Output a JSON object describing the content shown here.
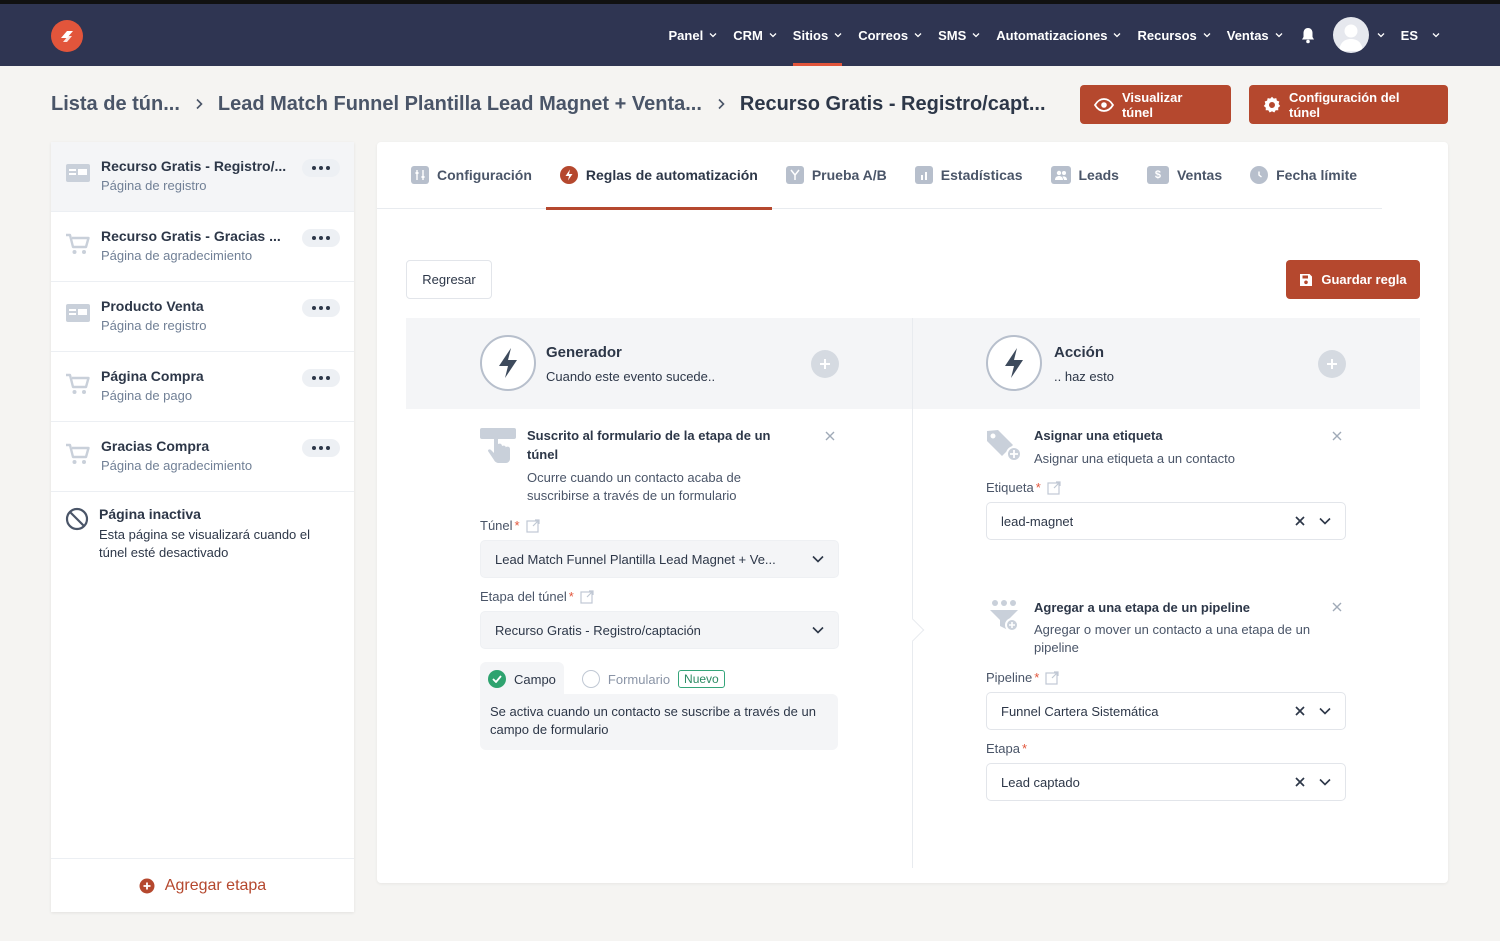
{
  "nav": {
    "items": [
      {
        "label": "Panel"
      },
      {
        "label": "CRM"
      },
      {
        "label": "Sitios",
        "active": true
      },
      {
        "label": "Correos"
      },
      {
        "label": "SMS"
      },
      {
        "label": "Automatizaciones"
      },
      {
        "label": "Recursos"
      },
      {
        "label": "Ventas"
      }
    ],
    "lang": "ES"
  },
  "breadcrumb": {
    "items": [
      "Lista de tún...",
      "Lead Match Funnel Plantilla Lead Magnet + Venta...",
      "Recurso Gratis - Registro/capt..."
    ]
  },
  "header_buttons": {
    "preview": "Visualizar túnel",
    "settings": "Configuración del túnel"
  },
  "sidebar": {
    "steps": [
      {
        "title": "Recurso Gratis - Registro/...",
        "subtitle": "Página de registro",
        "icon": "form-page-icon"
      },
      {
        "title": "Recurso Gratis - Gracias ...",
        "subtitle": "Página de agradecimiento",
        "icon": "cart-icon"
      },
      {
        "title": "Producto Venta",
        "subtitle": "Página de registro",
        "icon": "form-page-icon"
      },
      {
        "title": "Página Compra",
        "subtitle": "Página de pago",
        "icon": "cart-icon"
      },
      {
        "title": "Gracias Compra",
        "subtitle": "Página de agradecimiento",
        "icon": "cart-icon"
      }
    ],
    "inactive": {
      "title": "Página inactiva",
      "description": "Esta página se visualizará cuando el túnel esté desactivado"
    },
    "add_step": "Agregar etapa"
  },
  "tabs": [
    {
      "label": "Configuración",
      "icon": "sliders-icon"
    },
    {
      "label": "Reglas de automatización",
      "icon": "bolt-icon",
      "active": true
    },
    {
      "label": "Prueba A/B",
      "icon": "split-icon"
    },
    {
      "label": "Estadísticas",
      "icon": "bar-chart-icon"
    },
    {
      "label": "Leads",
      "icon": "users-icon"
    },
    {
      "label": "Ventas",
      "icon": "dollar-icon"
    },
    {
      "label": "Fecha límite",
      "icon": "clock-icon"
    }
  ],
  "actions": {
    "back": "Regresar",
    "save": "Guardar regla"
  },
  "trigger": {
    "title": "Generador",
    "subtitle": "Cuando este evento sucede..",
    "block": {
      "title": "Suscrito al formulario de la etapa de un túnel",
      "description": "Ocurre cuando un contacto acaba de suscribirse a través de un formulario"
    },
    "funnel_label": "Túnel",
    "funnel_value": "Lead Match Funnel Plantilla Lead Magnet + Ve...",
    "step_label": "Etapa del túnel",
    "step_value": "Recurso Gratis - Registro/captación",
    "option_field": "Campo",
    "option_form": "Formulario",
    "option_badge": "Nuevo",
    "option_desc": "Se activa cuando un contacto se suscribe a través de un campo de formulario"
  },
  "action": {
    "title": "Acción",
    "subtitle": ".. haz esto",
    "tag_block": {
      "title": "Asignar una etiqueta",
      "description": "Asignar una etiqueta a un contacto",
      "field_label": "Etiqueta",
      "field_value": "lead-magnet"
    },
    "pipeline_block": {
      "title": "Agregar a una etapa de un pipeline",
      "description": "Agregar o mover un contacto a una etapa de un pipeline",
      "pipeline_label": "Pipeline",
      "pipeline_value": "Funnel Cartera Sistemática",
      "stage_label": "Etapa",
      "stage_value": "Lead captado"
    }
  },
  "colors": {
    "topbar": "#2f3552",
    "accent": "#b5482e",
    "brand": "#e2553b",
    "success": "#35a57a"
  }
}
